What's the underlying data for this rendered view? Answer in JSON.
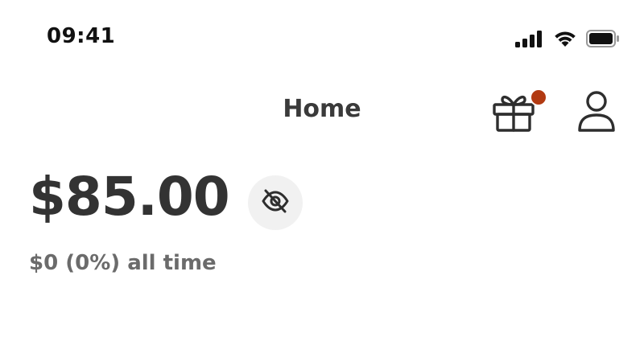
{
  "status_bar": {
    "time": "09:41",
    "icons": [
      "cellular-signal-icon",
      "wifi-icon",
      "battery-icon"
    ]
  },
  "header": {
    "title": "Home",
    "gift_icon": "gift-icon",
    "gift_has_notification": true,
    "notification_color": "#b23a12",
    "profile_icon": "user-icon"
  },
  "balance": {
    "amount": "$85.00",
    "toggle_icon": "eye-slash-icon",
    "change_text": "$0 (0%) all time"
  },
  "colors": {
    "background": "#ffffff",
    "text_primary": "#333333",
    "text_secondary": "#6b6b6b",
    "icon_button_bg": "#f1f1f1",
    "accent": "#b23a12"
  }
}
